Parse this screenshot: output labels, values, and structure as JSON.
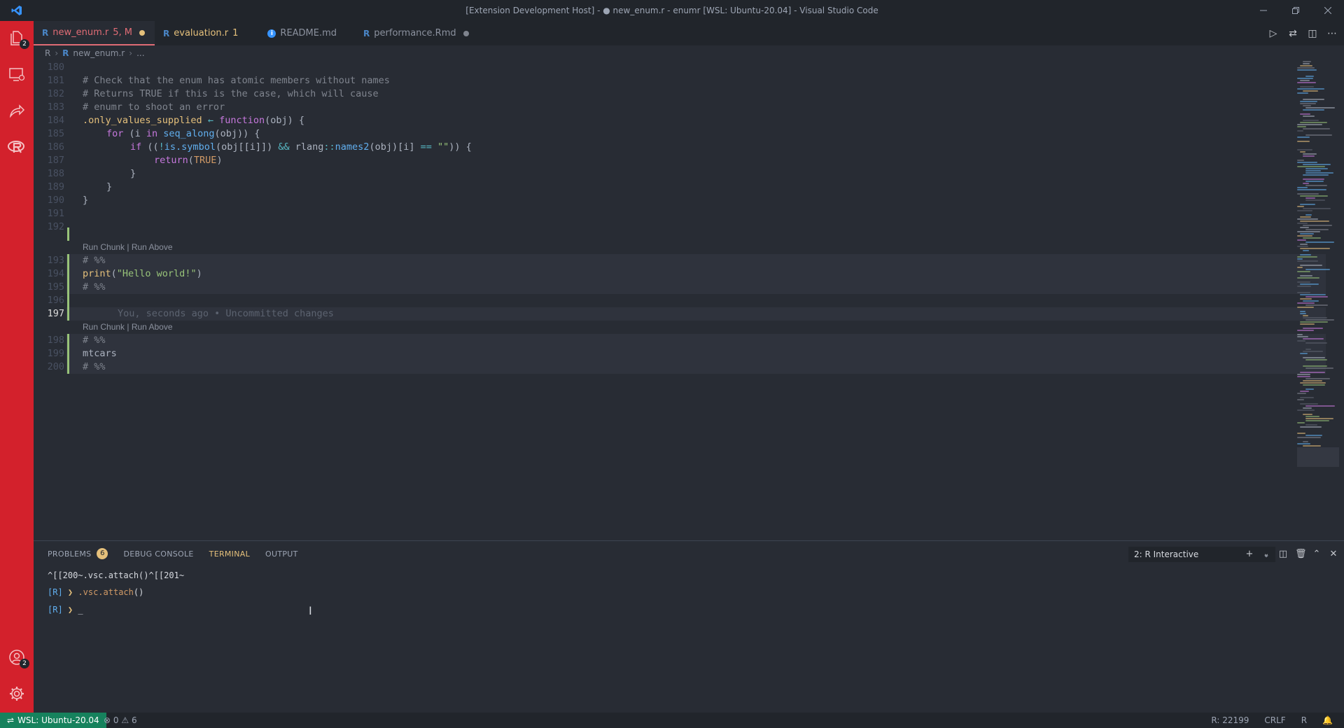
{
  "window": {
    "title": "[Extension Development Host] - ● new_enum.r - enumr [WSL: Ubuntu-20.04] - Visual Studio Code"
  },
  "activity_bar": {
    "explorer_badge": "2",
    "account_badge": "2"
  },
  "tabs": [
    {
      "label": "new_enum.r",
      "status": "5, M",
      "icon": "R",
      "modified": true
    },
    {
      "label": "evaluation.r",
      "status": "1",
      "icon": "R",
      "modified": false
    },
    {
      "label": "README.md",
      "status": "",
      "icon": "i",
      "modified": false
    },
    {
      "label": "performance.Rmd",
      "status": "",
      "icon": "R",
      "modified": true
    }
  ],
  "breadcrumbs": {
    "folder": "R",
    "file": "new_enum.r",
    "more": "..."
  },
  "editor": {
    "line_numbers": [
      "180",
      "181",
      "182",
      "183",
      "184",
      "185",
      "186",
      "187",
      "188",
      "189",
      "190",
      "191",
      "192",
      "193",
      "194",
      "195",
      "196",
      "197",
      "198",
      "199",
      "200"
    ],
    "codelens_label": "Run Chunk | Run Above",
    "blame_text": "You, seconds ago • Uncommitted changes",
    "code": {
      "l181": "# Check that the enum has atomic members without names",
      "l182": "# Returns TRUE if this is the case, which will cause",
      "l183": "# enumr to shoot an error",
      "l184_name": ".only_values_supplied",
      "l184_arrow": " ← ",
      "l184_fn": "function",
      "l184_rest": "(obj) {",
      "l185_kw": "for",
      "l185_a": " (i ",
      "l185_in": "in",
      "l185_fn": " seq_along",
      "l185_rest": "(obj)) {",
      "l186_kw": "if",
      "l186_a": " ((",
      "l186_not": "!",
      "l186_fn1": "is.symbol",
      "l186_b": "(obj[[i]]) ",
      "l186_and": "&&",
      "l186_c": " rlang",
      "l186_ns": "::",
      "l186_fn2": "names2",
      "l186_d": "(obj)[i] ",
      "l186_eq": "==",
      "l186_str": " \"\"",
      "l186_e": ")) {",
      "l187_fn": "return",
      "l187_a": "(",
      "l187_true": "TRUE",
      "l187_b": ")",
      "l188": "}",
      "l189": "}",
      "l190": "}",
      "l193": "# %%",
      "l194_fn": "print",
      "l194_a": "(",
      "l194_str": "\"Hello world!\"",
      "l194_b": ")",
      "l195": "# %%",
      "l198": "# %%",
      "l199": "mtcars",
      "l200": "# %%"
    }
  },
  "panel": {
    "tabs": [
      {
        "label": "PROBLEMS",
        "badge": "6"
      },
      {
        "label": "DEBUG CONSOLE",
        "badge": ""
      },
      {
        "label": "TERMINAL",
        "badge": ""
      },
      {
        "label": "OUTPUT",
        "badge": ""
      }
    ],
    "terminal_selector": "2: R Interactive",
    "terminal": {
      "line1": "^[[200~.vsc.attach()^[[201~",
      "prompt": "[R]",
      "arrow": "❯",
      "cmd_fn": ".vsc.attach",
      "cmd_paren": "()",
      "cursor": "_"
    }
  },
  "statusbar": {
    "remote": "WSL: Ubuntu-20.04",
    "errors": "0",
    "warnings": "6",
    "r_session": "R: 22199",
    "eol": "CRLF",
    "language": "R"
  },
  "colors": {
    "activity_bar": "#d3212c",
    "remote_indicator": "#16825d",
    "accent": "#e5c07b"
  }
}
